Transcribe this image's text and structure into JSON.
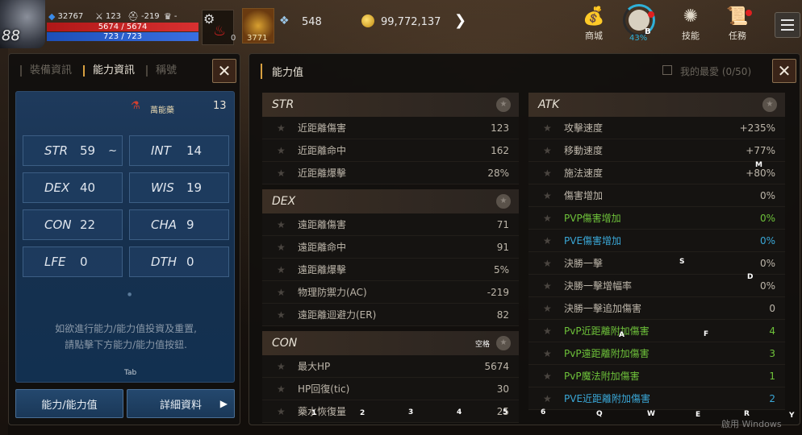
{
  "hud": {
    "level": "88",
    "exp_value": "32767",
    "sword_value": "123",
    "helmet_value": "-219",
    "trophy_value": "-",
    "hp_text": "5674 / 5674",
    "mp_text": "723 / 723",
    "potion_count": "0",
    "feather_count": "3771",
    "crystal_value": "548",
    "gold_value": "99,772,137",
    "shop_label": "商城",
    "progress_pct": "43%",
    "progress_key": "B",
    "skill_label": "技能",
    "quest_label": "任務"
  },
  "left_panel": {
    "tabs": [
      "裝備資訊",
      "能力資訊",
      "稱號"
    ],
    "elixir_label": "萬能藥",
    "elixir_count": "13",
    "stats": [
      {
        "name": "STR",
        "value": "59",
        "extra": "~"
      },
      {
        "name": "INT",
        "value": "14",
        "extra": ""
      },
      {
        "name": "DEX",
        "value": "40",
        "extra": ""
      },
      {
        "name": "WIS",
        "value": "19",
        "extra": ""
      },
      {
        "name": "CON",
        "value": "22",
        "extra": ""
      },
      {
        "name": "CHA",
        "value": "9",
        "extra": ""
      },
      {
        "name": "LFE",
        "value": "0",
        "extra": ""
      },
      {
        "name": "DTH",
        "value": "0",
        "extra": ""
      }
    ],
    "help_line1": "如欲進行能力/能力值投資及重置,",
    "help_line2": "請點擊下方能力/能力值按鈕.",
    "tab_hint": "Tab",
    "btn_ability": "能力/能力值",
    "btn_detail": "詳細資料"
  },
  "right_panel": {
    "title": "能力值",
    "favorites": "我的最愛 (0/50)",
    "groups_left": [
      {
        "title": "STR",
        "rows": [
          {
            "label": "近距離傷害",
            "value": "123"
          },
          {
            "label": "近距離命中",
            "value": "162"
          },
          {
            "label": "近距離爆擊",
            "value": "28%"
          }
        ]
      },
      {
        "title": "DEX",
        "rows": [
          {
            "label": "遠距離傷害",
            "value": "71"
          },
          {
            "label": "遠距離命中",
            "value": "91"
          },
          {
            "label": "遠距離爆擊",
            "value": "5%"
          },
          {
            "label": "物理防禦力(AC)",
            "value": "-219"
          },
          {
            "label": "遠距離迴避力(ER)",
            "value": "82"
          }
        ]
      },
      {
        "title": "CON",
        "key_hint": "空格",
        "rows": [
          {
            "label": "最大HP",
            "value": "5674"
          },
          {
            "label": "HP回復(tic)",
            "value": "30"
          },
          {
            "label": "藥水恢復量",
            "value": "25"
          }
        ]
      }
    ],
    "group_right": {
      "title": "ATK",
      "rows": [
        {
          "label": "攻擊速度",
          "value": "+235%",
          "type": "normal"
        },
        {
          "label": "移動速度",
          "value": "+77%",
          "type": "normal"
        },
        {
          "label": "施法速度",
          "value": "+80%",
          "type": "normal"
        },
        {
          "label": "傷害增加",
          "value": "0%",
          "type": "normal"
        },
        {
          "label": "PVP傷害增加",
          "value": "0%",
          "type": "pvp"
        },
        {
          "label": "PVE傷害增加",
          "value": "0%",
          "type": "pve"
        },
        {
          "label": "決勝一擊",
          "value": "0%",
          "type": "normal"
        },
        {
          "label": "決勝一擊增幅率",
          "value": "0%",
          "type": "normal"
        },
        {
          "label": "決勝一擊追加傷害",
          "value": "0",
          "type": "normal"
        },
        {
          "label": "PvP近距離附加傷害",
          "value": "4",
          "type": "pvp"
        },
        {
          "label": "PvP遠距離附加傷害",
          "value": "3",
          "type": "pvp"
        },
        {
          "label": "PvP魔法附加傷害",
          "value": "1",
          "type": "pvp"
        },
        {
          "label": "PVE近距離附加傷害",
          "value": "2",
          "type": "pve"
        }
      ]
    }
  },
  "key_hints": {
    "m": "M",
    "s": "S",
    "d": "D",
    "a": "A",
    "f": "F",
    "n1": "1",
    "n2": "2",
    "n3": "3",
    "n4": "4",
    "n5": "5",
    "n6": "6",
    "q": "Q",
    "w": "W",
    "e": "E",
    "r": "R",
    "y": "Y"
  },
  "watermark": "啟用 Windows",
  "icons": {
    "exp": "exp-crystal-icon",
    "sword": "sword-icon",
    "helmet": "helmet-icon",
    "trophy": "trophy-icon",
    "gear": "gear-icon",
    "potion": "potion-icon",
    "feather": "feather-icon",
    "crystal": "crystal-icon",
    "gold": "gold-coin-icon",
    "shop": "shop-bag-icon",
    "skill": "skill-swirl-icon",
    "quest": "quest-scroll-icon",
    "menu": "hamburger-menu-icon",
    "star": "star-icon",
    "close": "close-icon"
  },
  "colors": {
    "hp_bar": "#d83030",
    "mp_bar": "#3a6fe0",
    "pvp_text": "#6ec23a",
    "pve_text": "#3aa8d8",
    "accent": "#d8a040",
    "stat_panel": "#1e3a5c"
  }
}
